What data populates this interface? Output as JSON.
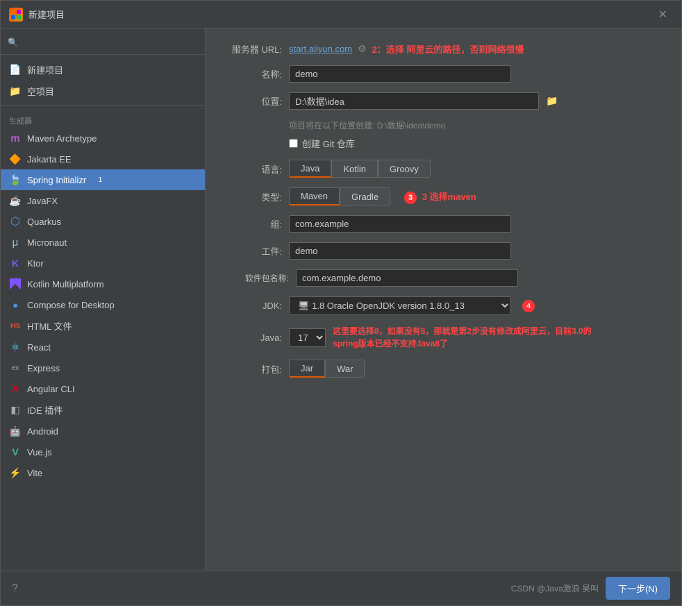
{
  "titleBar": {
    "title": "新建项目",
    "closeLabel": "✕"
  },
  "sidebar": {
    "searchPlaceholder": "",
    "topItems": [
      {
        "id": "new-project",
        "label": "新建项目",
        "icon": ""
      },
      {
        "id": "empty-project",
        "label": "空项目",
        "icon": ""
      }
    ],
    "sectionLabel": "生成器",
    "generatorItems": [
      {
        "id": "maven-archetype",
        "label": "Maven Archetype",
        "icon": "m",
        "iconColor": "#b05cce"
      },
      {
        "id": "jakarta-ee",
        "label": "Jakarta EE",
        "icon": "🔶",
        "iconColor": "#e8a020"
      },
      {
        "id": "spring-initializr",
        "label": "Spring Initializr",
        "icon": "🍃",
        "iconColor": "#6db33f",
        "active": true,
        "badge": "1"
      },
      {
        "id": "javafx",
        "label": "JavaFX",
        "icon": "☕",
        "iconColor": "#5382a1"
      },
      {
        "id": "quarkus",
        "label": "Quarkus",
        "icon": "⬡",
        "iconColor": "#4695eb"
      },
      {
        "id": "micronaut",
        "label": "Micronaut",
        "icon": "μ",
        "iconColor": "#90c4e4"
      },
      {
        "id": "ktor",
        "label": "Ktor",
        "icon": "K",
        "iconColor": "#7f52ff"
      },
      {
        "id": "kotlin-multiplatform",
        "label": "Kotlin Multiplatform",
        "icon": "K",
        "iconColor": "#7f52ff"
      },
      {
        "id": "compose-desktop",
        "label": "Compose for Desktop",
        "icon": "●",
        "iconColor": "#4695eb"
      },
      {
        "id": "html-file",
        "label": "HTML 文件",
        "icon": "H",
        "iconColor": "#e44d26"
      },
      {
        "id": "react",
        "label": "React",
        "icon": "⚛",
        "iconColor": "#61dafb"
      },
      {
        "id": "express",
        "label": "Express",
        "icon": "ex",
        "iconColor": "#aaa"
      },
      {
        "id": "angular-cli",
        "label": "Angular CLI",
        "icon": "A",
        "iconColor": "#dd0031"
      },
      {
        "id": "ide-plugin",
        "label": "IDE 插件",
        "icon": "◧",
        "iconColor": "#aaa"
      },
      {
        "id": "android",
        "label": "Android",
        "icon": "🤖",
        "iconColor": "#3ddc84"
      },
      {
        "id": "vuejs",
        "label": "Vue.js",
        "icon": "V",
        "iconColor": "#42b883"
      },
      {
        "id": "vite",
        "label": "Vite",
        "icon": "⚡",
        "iconColor": "#bd34fe"
      }
    ]
  },
  "form": {
    "serverUrlLabel": "服务器 URL:",
    "serverUrlValue": "start.aliyun.com",
    "serverUrlAnnotation": "2：选择 阿里云的路径，否则网络很慢",
    "nameLabel": "名称:",
    "nameValue": "demo",
    "locationLabel": "位置:",
    "locationValue": "D:\\数据\\idea",
    "locationHint": "项目将在以下位置创建: D:\\数据\\idea\\demo",
    "gitCheckboxLabel": "创建 Git 仓库",
    "languageLabel": "语言:",
    "languageOptions": [
      "Java",
      "Kotlin",
      "Groovy"
    ],
    "languageActive": "Java",
    "typeLabel": "类型:",
    "typeOptions": [
      "Maven",
      "Gradle"
    ],
    "typeActive": "Maven",
    "typeAnnotation": "3  选择maven",
    "groupLabel": "组:",
    "groupValue": "com.example",
    "artifactLabel": "工件:",
    "artifactValue": "demo",
    "packageLabel": "软件包名称:",
    "packageValue": "com.example.demo",
    "jdkLabel": "JDK:",
    "jdkValue": "1.8 Oracle OpenJDK version 1.8.0_13",
    "javaLabel": "Java:",
    "javaValue": "17",
    "javaAnnotation": "这里要选择8，如果没有8，那就是第2步没有修改成阿里云，目前3.0的spring版本已经不支持Java8了",
    "packageTypeLabel": "打包:",
    "packageTypeOptions": [
      "Jar",
      "War"
    ]
  },
  "bottomBar": {
    "watermark": "CSDN @Java激浪 昊叫",
    "nextLabel": "下一步(N)",
    "helpLabel": "?"
  }
}
